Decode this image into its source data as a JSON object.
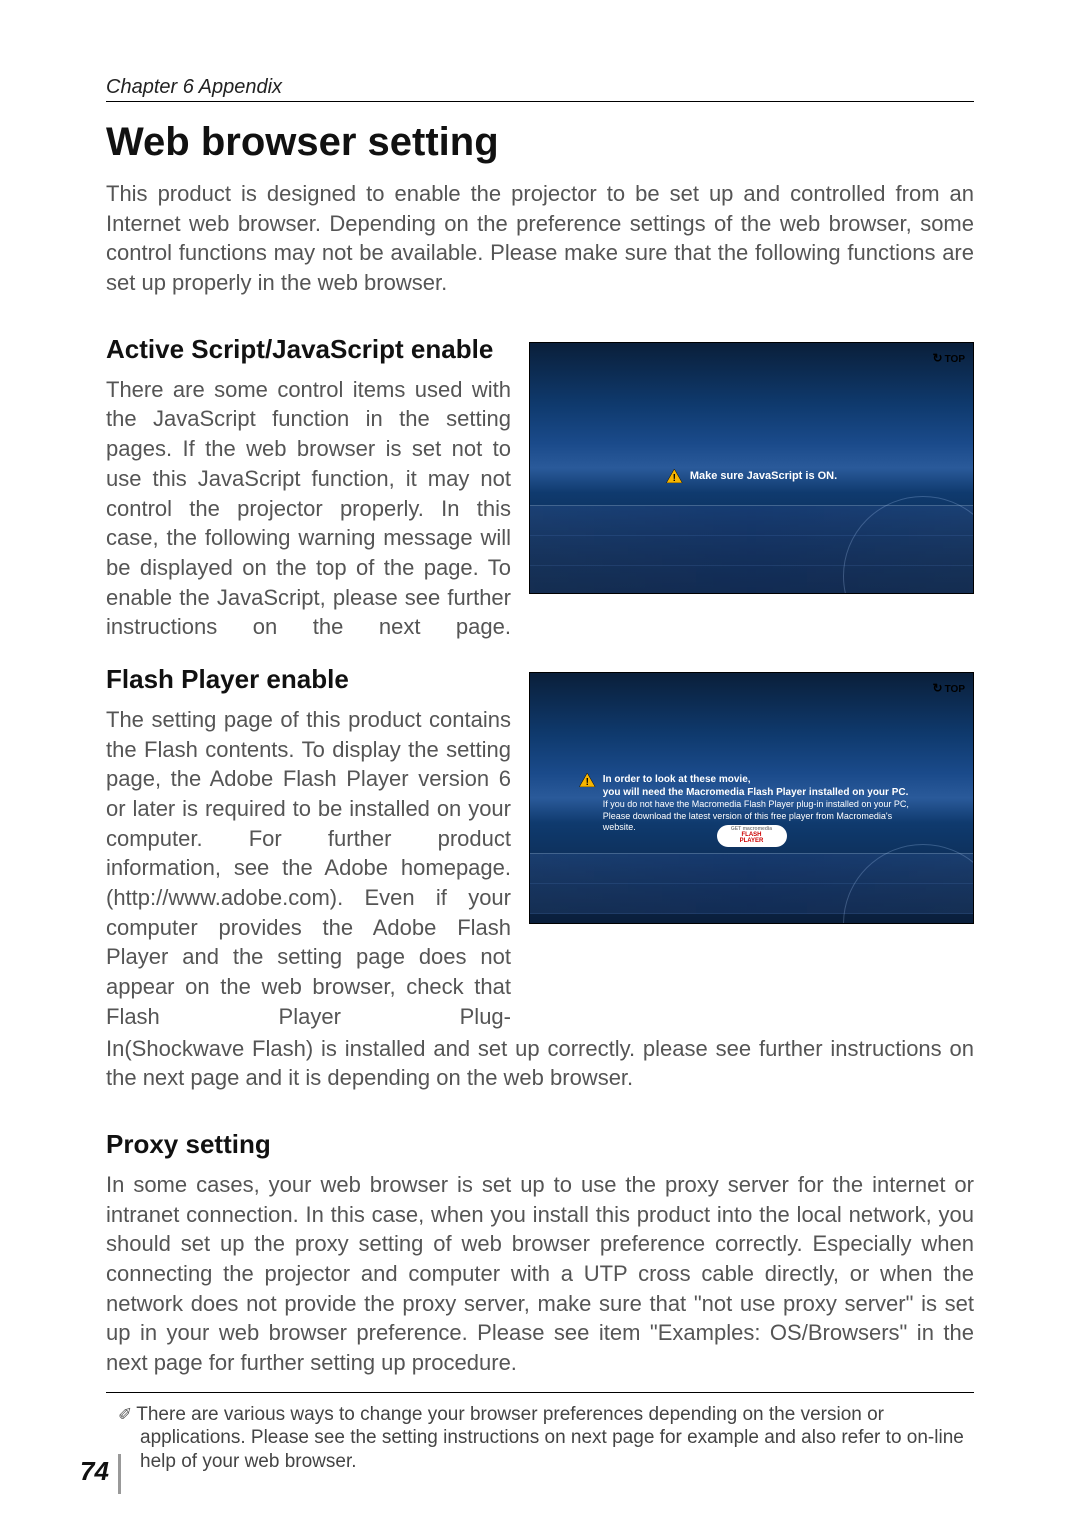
{
  "chapter": "Chapter 6 Appendix",
  "title": "Web browser setting",
  "intro": "This product is designed to enable the projector to be set up and controlled from an Internet web browser. Depending on the preference settings of the web browser, some control functions may not be available. Please make sure that the following functions are set up properly in the web browser.",
  "sections": {
    "active": {
      "title": "Active Script/JavaScript enable",
      "body": "There are some control items used with the JavaScript function in the setting pages. If the web browser is set not to use this JavaScript function, it may not control the projector properly. In this case, the following warning message will be displayed on the top of the page. To enable the JavaScript, please see further instructions on the next page.",
      "screenshot": {
        "top_btn": "TOP",
        "msg": "Make sure JavaScript is ON."
      }
    },
    "flash": {
      "title": "Flash Player enable",
      "body_col": "The setting page of this product contains the Flash contents. To display the setting page, the Adobe Flash Player version 6 or later is required to be installed on your computer. For further product information, see the Adobe homepage. (http://www.adobe.com). Even if your computer provides the Adobe Flash Player and the setting page does not appear on the web browser, check that Flash Player Plug-",
      "body_full": "In(Shockwave Flash) is installed and set up correctly. please see further instructions on the next page and it is depending on the web browser.",
      "screenshot": {
        "top_btn": "TOP",
        "line1": "In order to look at these movie,",
        "line2": "you will need the Macromedia Flash Player installed on your PC.",
        "line3": "If you do not have the Macromedia Flash Player plug-in installed on your PC,",
        "line4": "Please download the latest version of this free player from Macromedia's website.",
        "btn1": "GET macromedia",
        "btn2": "FLASH",
        "btn3": "PLAYER"
      }
    },
    "proxy": {
      "title": "Proxy setting",
      "body": "In some cases, your web browser is set up to use the proxy server for the internet or intranet connection. In this case, when you install this product into the local network, you should set up the proxy setting of web browser preference correctly. Especially when connecting the projector and computer with a UTP cross cable directly, or when the network does not provide the proxy server, make sure that \"not use proxy server\" is set up in your web browser preference.  Please see item \"Examples: OS/Browsers\" in the next page for further setting up procedure."
    }
  },
  "footnote": "There are various ways to change your browser preferences depending on the version or applications. Please see the setting instructions on next page for example and also refer to on-line help of your web browser.",
  "page_number": "74"
}
